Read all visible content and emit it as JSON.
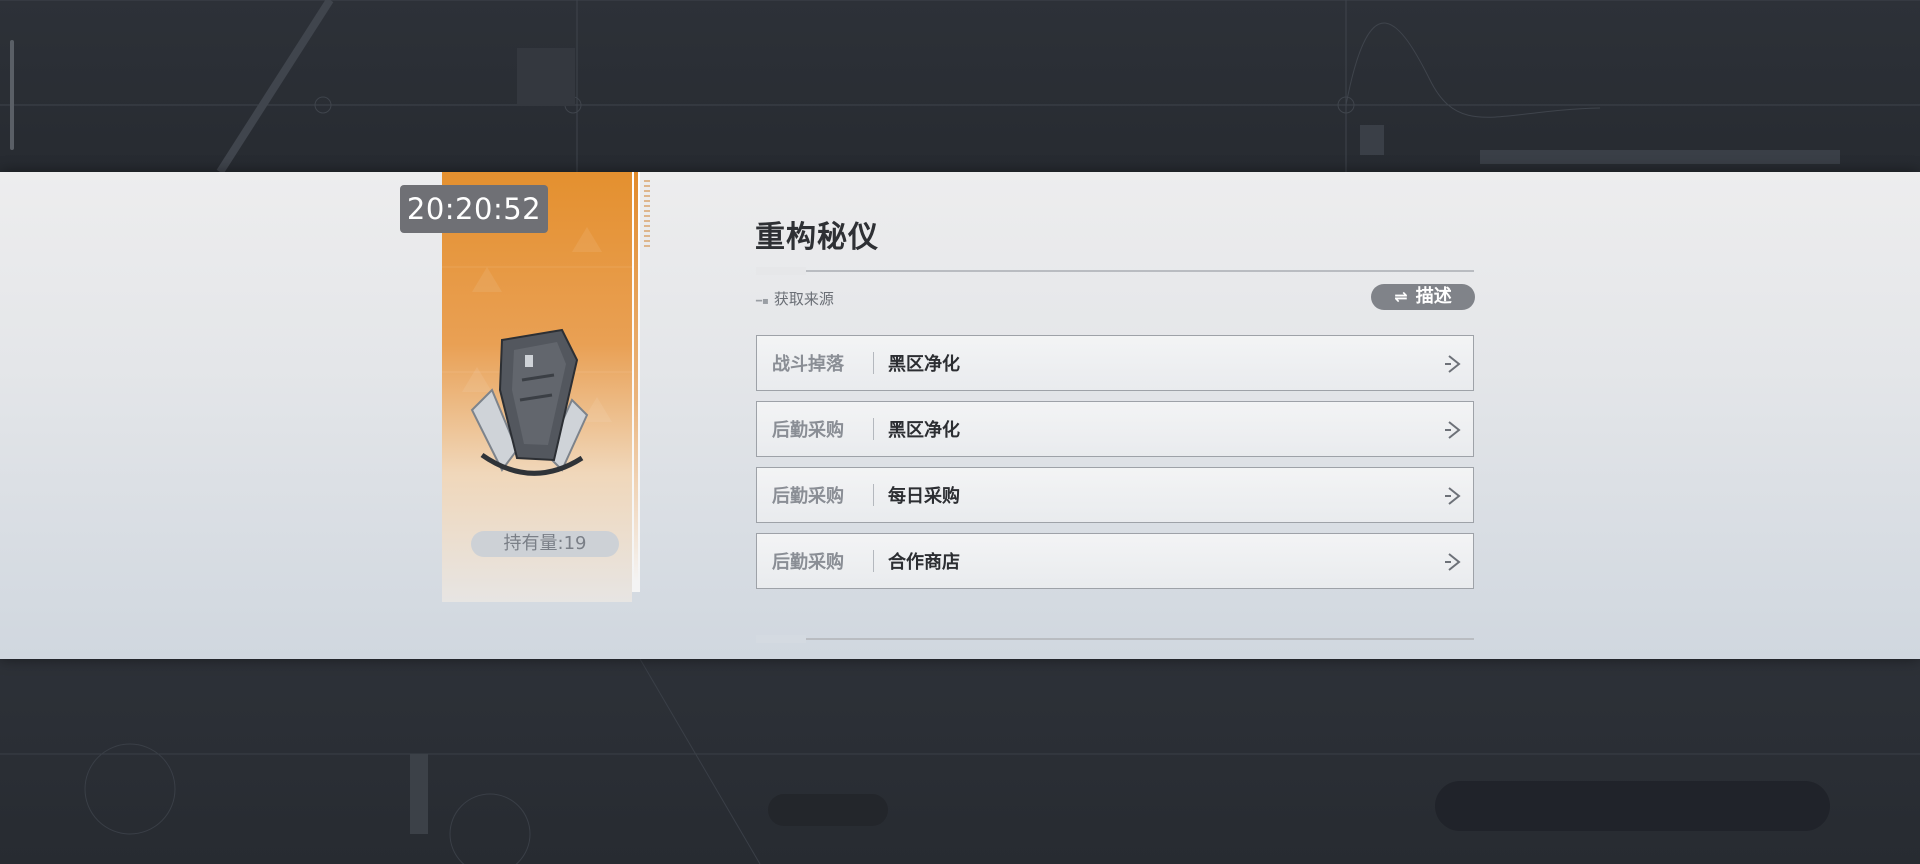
{
  "item": {
    "timer": "20:20:52",
    "holding": "持有量:19",
    "title": "重构秘仪"
  },
  "sources": {
    "header": "获取来源",
    "toggle_label": "描述",
    "rows": [
      {
        "type": "战斗掉落",
        "name": "黑区净化"
      },
      {
        "type": "后勤采购",
        "name": "黑区净化"
      },
      {
        "type": "后勤采购",
        "name": "每日采购"
      },
      {
        "type": "后勤采购",
        "name": "合作商店"
      }
    ]
  },
  "colors": {
    "accent_orange": "#e4902f",
    "toggle_bg": "#808389",
    "timer_bg": "#6f7075"
  },
  "icons": [
    "swap-arrows-icon",
    "chevron-right-icon",
    "item-icon"
  ]
}
